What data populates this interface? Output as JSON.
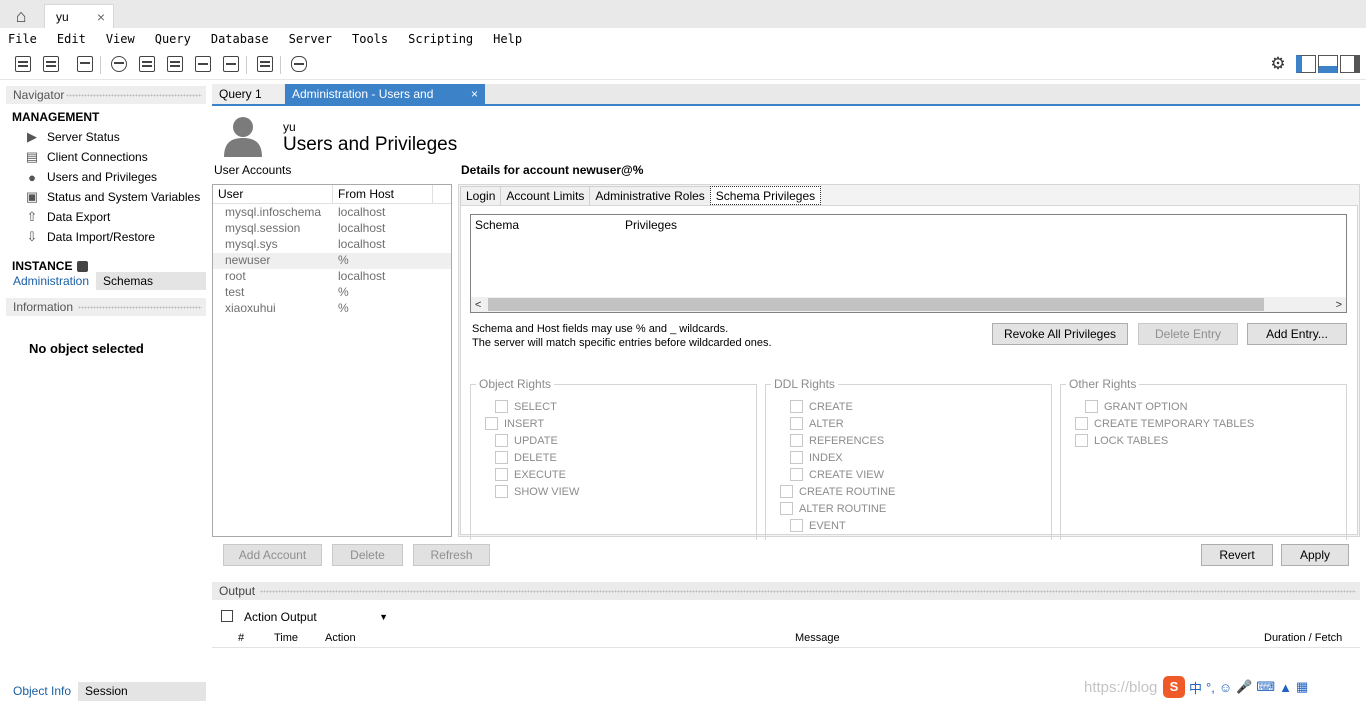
{
  "connection_tab": {
    "label": "yu"
  },
  "menu": [
    "File",
    "Edit",
    "View",
    "Query",
    "Database",
    "Server",
    "Tools",
    "Scripting",
    "Help"
  ],
  "navigator": {
    "title": "Navigator",
    "management_title": "MANAGEMENT",
    "management_items": [
      "Server Status",
      "Client Connections",
      "Users and Privileges",
      "Status and System Variables",
      "Data Export",
      "Data Import/Restore"
    ],
    "instance_title": "INSTANCE",
    "tabs": [
      "Administration",
      "Schemas"
    ],
    "information_title": "Information",
    "no_object": "No object selected",
    "bottom_tabs": [
      "Object Info",
      "Session"
    ]
  },
  "editor_tabs": [
    "Query 1",
    "Administration - Users and Privil..."
  ],
  "header": {
    "subtitle": "yu",
    "title": "Users and Privileges"
  },
  "accounts": {
    "label": "User Accounts",
    "columns": [
      "User",
      "From Host"
    ],
    "rows": [
      {
        "user": "mysql.infoschema",
        "host": "localhost"
      },
      {
        "user": "mysql.session",
        "host": "localhost"
      },
      {
        "user": "mysql.sys",
        "host": "localhost"
      },
      {
        "user": "newuser",
        "host": "%"
      },
      {
        "user": "root",
        "host": "localhost"
      },
      {
        "user": "test",
        "host": "%"
      },
      {
        "user": "xiaoxuhui",
        "host": "%"
      }
    ],
    "selected_index": 3
  },
  "details": {
    "title": "Details for account newuser@%",
    "tabs": [
      "Login",
      "Account Limits",
      "Administrative Roles",
      "Schema Privileges"
    ],
    "active_tab": "Schema Privileges",
    "table_columns": [
      "Schema",
      "Privileges"
    ],
    "hint_line1": "Schema and Host fields may use % and _ wildcards.",
    "hint_line2": "The server will match specific entries before wildcarded ones.",
    "buttons": {
      "revoke": "Revoke All Privileges",
      "delete": "Delete Entry",
      "add": "Add Entry..."
    },
    "object_rights": {
      "title": "Object Rights",
      "items": [
        "SELECT",
        "INSERT",
        "UPDATE",
        "DELETE",
        "EXECUTE",
        "SHOW VIEW"
      ]
    },
    "ddl_rights": {
      "title": "DDL Rights",
      "items": [
        "CREATE",
        "ALTER",
        "REFERENCES",
        "INDEX",
        "CREATE VIEW",
        "CREATE ROUTINE",
        "ALTER ROUTINE",
        "EVENT"
      ]
    },
    "other_rights": {
      "title": "Other Rights",
      "items": [
        "GRANT OPTION",
        "CREATE TEMPORARY TABLES",
        "LOCK TABLES"
      ]
    }
  },
  "bottom_buttons": {
    "add_account": "Add Account",
    "delete": "Delete",
    "refresh": "Refresh",
    "revert": "Revert",
    "apply": "Apply"
  },
  "output": {
    "title": "Output",
    "selector": "Action Output",
    "columns": [
      "#",
      "Time",
      "Action",
      "Message",
      "Duration / Fetch"
    ]
  },
  "watermark": "https://blog",
  "tray_icons": [
    "sogou-icon",
    "中",
    "°,",
    "emoji-icon",
    "mic-icon",
    "keyboard-icon",
    "shirt-icon",
    "grid-icon"
  ]
}
